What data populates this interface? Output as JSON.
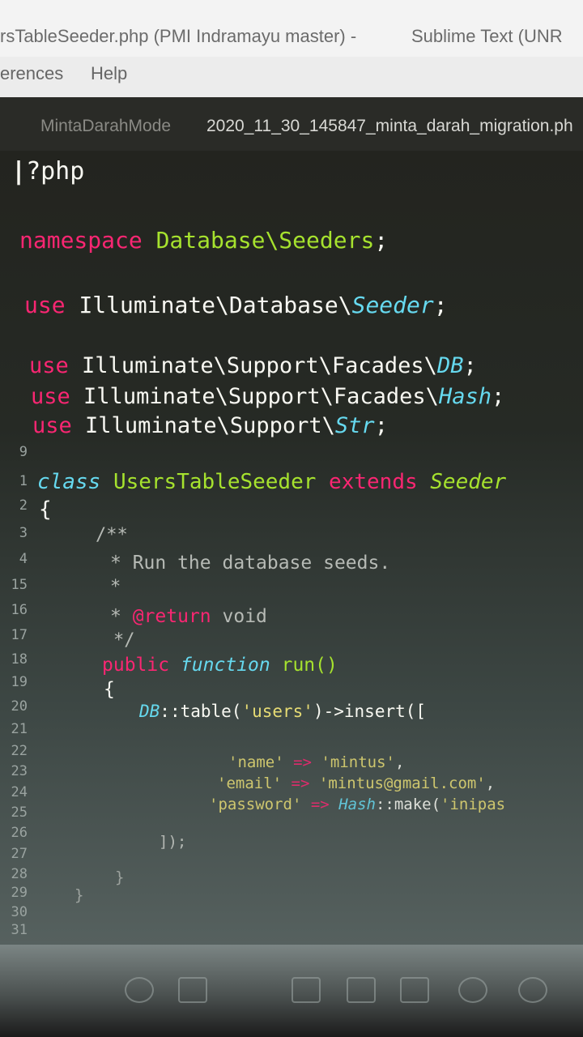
{
  "window": {
    "title": "rsTableSeeder.php (PMI Indramayu master) -",
    "app": "Sublime Text (UNR"
  },
  "menu": {
    "items": [
      "erences",
      "Help"
    ]
  },
  "tabs": [
    {
      "label": "MintaDarahMode",
      "active": false
    },
    {
      "label": "2020_11_30_145847_minta_darah_migration.ph",
      "active": true
    }
  ],
  "gutter": {
    "lines": [
      "9",
      "1",
      "2",
      "3",
      "4",
      "15",
      "16",
      "17",
      "18",
      "19",
      "20",
      "21",
      "22",
      "23",
      "24",
      "25",
      "26",
      "27",
      "28",
      "29",
      "30",
      "31"
    ]
  },
  "code": {
    "php_open": "?php",
    "namespace_kw": "namespace",
    "namespace_path": "Database\\Seeders",
    "use_kw": "use",
    "use1_path": "Illuminate\\Database\\",
    "use1_type": "Seeder",
    "use2_path": "Illuminate\\Support\\Facades\\",
    "use2_type": "DB",
    "use3_path": "Illuminate\\Support\\Facades\\",
    "use3_type": "Hash",
    "use4_path": "Illuminate\\Support\\",
    "use4_type": "Str",
    "class_kw": "class",
    "class_name": "UsersTableSeeder",
    "extends_kw": "extends",
    "parent_class": "Seeder",
    "doc_open": "/**",
    "doc_line1": "* Run the database seeds.",
    "doc_blank": "*",
    "doc_star": "*",
    "doc_return_tag": "@return",
    "doc_return_type": "void",
    "doc_close": "*/",
    "public_kw": "public",
    "function_kw": "function",
    "method_name": "run()",
    "db_class": "DB",
    "table_call": "::table(",
    "table_name": "'users'",
    "insert_call": ")->insert([",
    "key_name": "'name'",
    "val_name": "'mintus'",
    "key_email": "'email'",
    "val_email": "'mintus@gmail.com'",
    "key_password": "'password'",
    "hash_class": "Hash",
    "hash_make": "::make(",
    "val_password": "'inipas",
    "arrow": "=>",
    "close_insert": "]);",
    "close_brace": "}",
    "open_brace": "{"
  }
}
